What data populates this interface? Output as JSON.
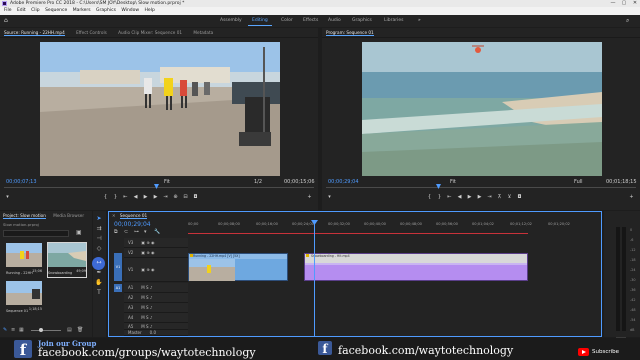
{
  "window": {
    "title": "Adobe Premiere Pro CC 2018 - C:\\Users\\SM JOY\\Desktop\\ Slow motion.prproj *",
    "controls": [
      "—",
      "▢",
      "✕"
    ]
  },
  "menu": [
    "File",
    "Edit",
    "Clip",
    "Sequence",
    "Markers",
    "Graphics",
    "Window",
    "Help"
  ],
  "workspaces": {
    "tabs": [
      "Assembly",
      "Editing",
      "Color",
      "Effects",
      "Audio",
      "Graphics",
      "Libraries"
    ],
    "active": "Editing",
    "more": "»"
  },
  "source_panel": {
    "tabs": [
      "Source: Running - 22HH.mp4",
      "Effect Controls",
      "Audio Clip Mixer: Sequence 01",
      "Metadata"
    ],
    "timecode": "00;00;07;13",
    "fit": "Fit",
    "quality": "1/2",
    "duration": "00;00;15;06"
  },
  "program_panel": {
    "tab": "Program: Sequence 01",
    "timecode": "00;00;29;04",
    "fit": "Fit",
    "quality": "Full",
    "duration": "00;01;18;15"
  },
  "project_panel": {
    "tabs": [
      "Project: Slow motion",
      "Media Browser"
    ],
    "project_file": "Slow motion.prproj",
    "items": [
      {
        "name": "Running - 22HH",
        "duration": "15;06"
      },
      {
        "name": "Snowboarding",
        "duration": "49;09"
      },
      {
        "name": "Sequence 01",
        "duration": "1;18;15"
      }
    ]
  },
  "timeline": {
    "tab": "Sequence 01",
    "timecode": "00;00;29;04",
    "ruler": [
      "00;00",
      "00;00;08;00",
      "00;00;16;00",
      "00;00;24;00",
      "00;00;32;00",
      "00;00;40;00",
      "00;00;48;00",
      "00;00;56;00",
      "00;01;04;02",
      "00;01;12;02",
      "00;01;20;02"
    ],
    "video_tracks": [
      "V3",
      "V2",
      "V1"
    ],
    "audio_tracks": [
      "A1",
      "A2",
      "A3",
      "A4",
      "A5",
      "A6"
    ],
    "source_patch": [
      "V1",
      "A1"
    ],
    "clips": [
      {
        "label": "Running - 22HH.mp4 [V] [5X]"
      },
      {
        "label": "Snowboarding - Hit.mp4"
      }
    ],
    "master": "Master",
    "master_value": "0.0"
  },
  "meters": [
    "0",
    "-6",
    "-12",
    "-18",
    "-24",
    "-30",
    "-36",
    "-42",
    "-48",
    "-54",
    "dB"
  ],
  "banner": {
    "join_text": "Join our Group",
    "group_url": "facebook.com/groups/waytotechnology",
    "page_url": "facebook.com/waytotechnology",
    "subscribe": "Subscribe"
  },
  "colors": {
    "accent": "#5aa6ff",
    "video_clip": "#6ea8e0",
    "audio_clip": "#b58df0",
    "playhead": "#4f9bff",
    "facebook": "#3b5998",
    "youtube": "#ff0000"
  }
}
